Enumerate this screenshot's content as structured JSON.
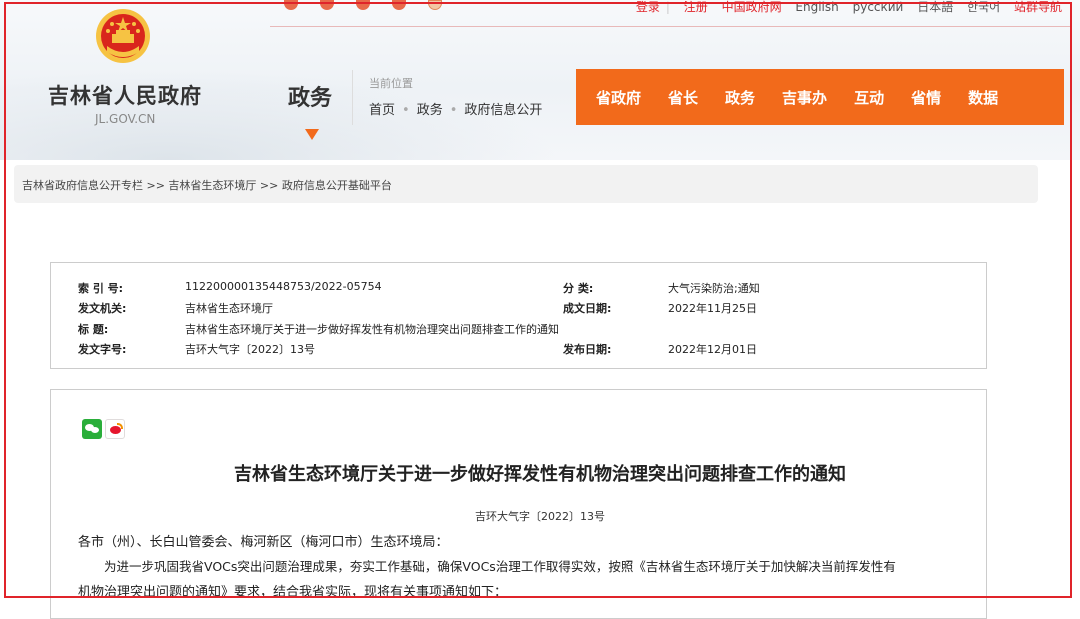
{
  "header": {
    "site_name": "吉林省人民政府",
    "site_domain": "JL.GOV.CN",
    "section_title": "政务",
    "location_label": "当前位置",
    "location_crumbs": [
      "首页",
      "政务",
      "政府信息公开"
    ]
  },
  "topbar": {
    "links": [
      "登录",
      "注册",
      "中国政府网",
      "English",
      "русский",
      "日本語",
      "한국어",
      "站群导航"
    ]
  },
  "nav": {
    "items": [
      "省政府",
      "省长",
      "政务",
      "吉事办",
      "互动",
      "省情",
      "数据"
    ]
  },
  "breadcrumb": "吉林省政府信息公开专栏 >> 吉林省生态环境厅 >> 政府信息公开基础平台",
  "meta": {
    "index_label": "索 引 号:",
    "index_value": "112200000135448753/2022-05754",
    "category_label": "分  类:",
    "category_value": "大气污染防治;通知",
    "issuer_label": "发文机关:",
    "issuer_value": "吉林省生态环境厅",
    "date_written_label": "成文日期:",
    "date_written_value": "2022年11月25日",
    "title_label": "标    题:",
    "title_value": "吉林省生态环境厅关于进一步做好挥发性有机物治理突出问题排查工作的通知",
    "doc_no_label": "发文字号:",
    "doc_no_value": "吉环大气字〔2022〕13号",
    "pub_date_label": "发布日期:",
    "pub_date_value": "2022年12月01日"
  },
  "article": {
    "title": "吉林省生态环境厅关于进一步做好挥发性有机物治理突出问题排查工作的通知",
    "doc_no": "吉环大气字〔2022〕13号",
    "recipients": "各市（州）、长白山管委会、梅河新区（梅河口市）生态环境局：",
    "para1_line1": "为进一步巩固我省VOCs突出问题治理成果，夯实工作基础，确保VOCs治理工作取得实效，按照《吉林省生态环境厅关于加快解决当前挥发性有",
    "para1_line2": "机物治理突出问题的通知》要求，结合我省实际，现将有关事项通知如下："
  },
  "colors": {
    "nav_bg": "#f26a1b",
    "frame": "#e0242a",
    "link_red": "#e0242a"
  }
}
